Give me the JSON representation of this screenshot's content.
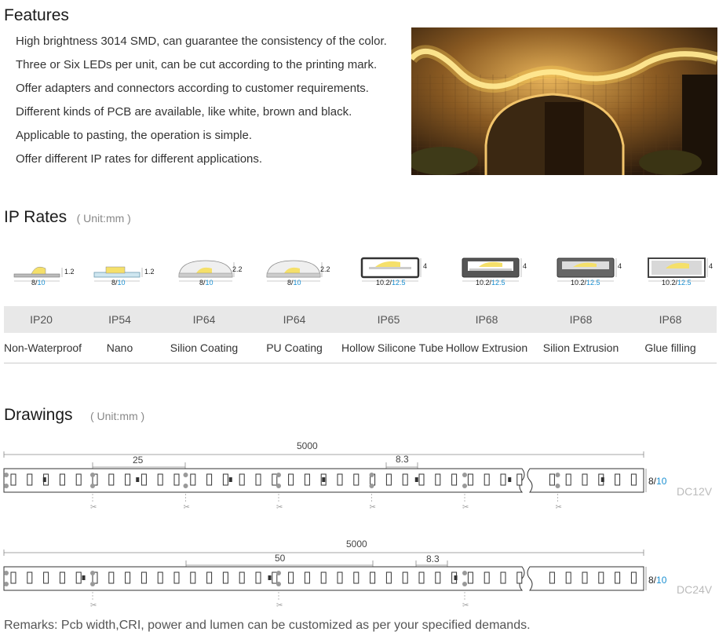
{
  "features": {
    "title": "Features",
    "items": [
      "High brightness 3014 SMD, can guarantee the consistency of the color.",
      "Three or Six LEDs per unit, can be cut according to the printing mark.",
      "Offer adapters and connectors according to customer requirements.",
      "Different kinds of PCB are available, like white, brown and black.",
      "Applicable to pasting, the operation is simple.",
      "Offer different IP rates for different applications."
    ]
  },
  "ip_rates": {
    "title": "IP Rates",
    "unit": "( Unit:mm )",
    "icons": [
      {
        "width_label_a": "8/",
        "width_label_b": "10",
        "height_label": "1.2"
      },
      {
        "width_label_a": "8/",
        "width_label_b": "10",
        "height_label": "1.2"
      },
      {
        "width_label_a": "8/",
        "width_label_b": "10",
        "height_label": "2.2"
      },
      {
        "width_label_a": "8/",
        "width_label_b": "10",
        "height_label": "2.2"
      },
      {
        "width_label_a": "10.2/",
        "width_label_b": "12.5",
        "height_label": "4"
      },
      {
        "width_label_a": "10.2/",
        "width_label_b": "12.5",
        "height_label": "4"
      },
      {
        "width_label_a": "10.2/",
        "width_label_b": "12.5",
        "height_label": "4"
      },
      {
        "width_label_a": "10.2/",
        "width_label_b": "12.5",
        "height_label": "4"
      }
    ],
    "rates": [
      "IP20",
      "IP54",
      "IP64",
      "IP64",
      "IP65",
      "IP68",
      "IP68",
      "IP68"
    ],
    "names": [
      "Non-Waterproof",
      "Nano",
      "Silion Coating",
      "PU Coating",
      "Hollow Silicone Tube",
      "Hollow Extrusion",
      "Silion Extrusion",
      "Glue filling"
    ]
  },
  "drawings": {
    "title": "Drawings",
    "unit": "( Unit:mm )",
    "strip1": {
      "total": "5000",
      "unit_len": "25",
      "pitch": "8.3",
      "width_a": "8/",
      "width_b": "10",
      "voltage": "DC12V"
    },
    "strip2": {
      "total": "5000",
      "unit_len": "50",
      "pitch": "8.3",
      "width_a": "8/",
      "width_b": "10",
      "voltage": "DC24V"
    }
  },
  "remarks": "Remarks: Pcb width,CRI, power and lumen can be customized as per your specified demands.",
  "colors": {
    "accent_blue": "#1a8fd1",
    "led_yellow": "#f5e06a",
    "grey_text": "#bbbbbb"
  }
}
